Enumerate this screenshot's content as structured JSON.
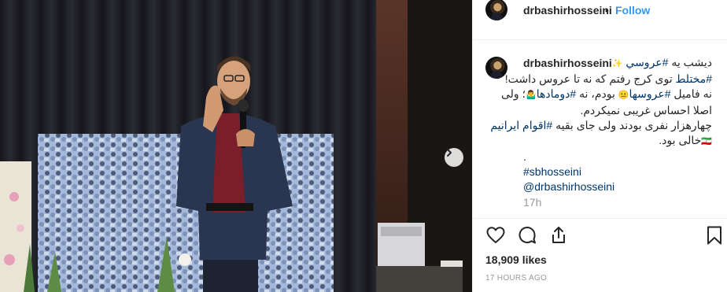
{
  "post": {
    "username": "drbashirhosseini",
    "follow_label": "Follow",
    "separator": "•",
    "caption": {
      "line1_a": "دیشب یه ",
      "line1_tag": "#عروسي",
      "line1_emoji": "✨",
      "line2_tag": "#مختلط",
      "line2_rest": " توی کرج رفتم که نه تا عروس داشت!",
      "line3_a": "نه فامیل ",
      "line3_tag1": "#عروسها",
      "line3_emoji1": "😐",
      "line3_b": " بودم، نه ",
      "line3_tag2": "#دومادها",
      "line3_emoji2": "🤷‍♂️",
      "line3_c": "؛ ولی",
      "line4": "اصلا احساس غریبی نمیکردم.",
      "line5_a": "چهارهزار نفری بودند ولی جای بقیه ",
      "line5_tag": "#اقوام ایرانیم",
      "line6_emoji": "🇮🇷",
      "line6_text": "خالی بود.",
      "dot_line": ".",
      "hashtag": "#sbhosseini",
      "mention": "@drbashirhosseini"
    },
    "time_short": "17h",
    "likes": "18,909 likes",
    "posted_ago": "17 HOURS AGO"
  },
  "icons": {
    "avatar": "profile-photo",
    "next": "chevron-right-icon",
    "like": "heart-icon",
    "comment": "comment-bubble-icon",
    "share": "share-icon",
    "save": "bookmark-icon"
  },
  "colors": {
    "link": "#3897f0",
    "tag": "#003569",
    "meta": "#999999",
    "text": "#262626"
  }
}
